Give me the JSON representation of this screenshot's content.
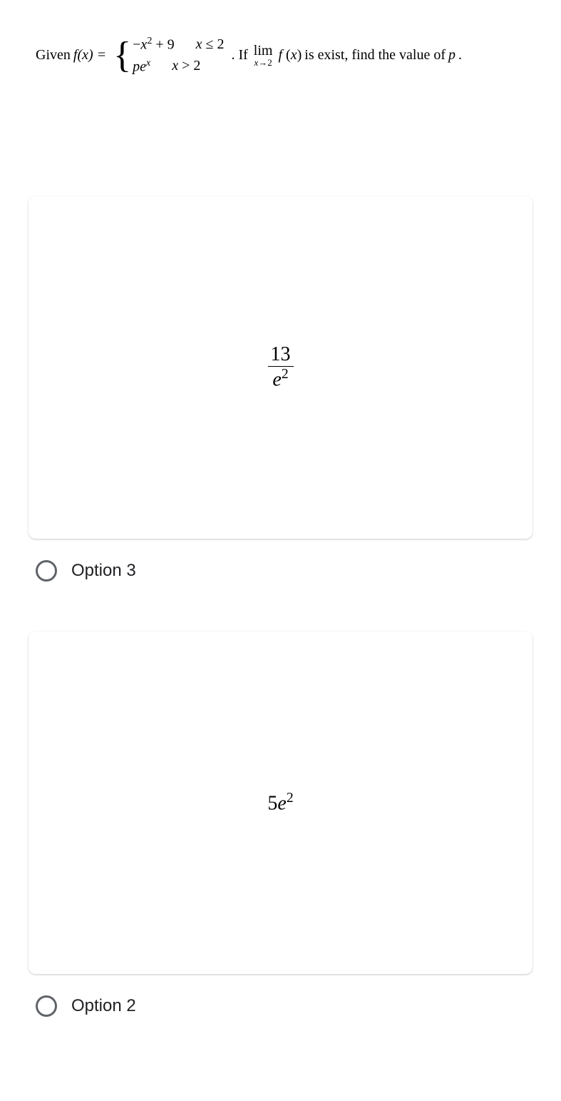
{
  "question": {
    "prefix": "Given ",
    "fx_label": "f(x) =",
    "piece1_expr": "−x² + 9",
    "piece1_cond": "x ≤ 2",
    "piece2_expr": "peˣ",
    "piece2_cond": "x > 2",
    "mid_text": ". If ",
    "limit_op": "lim",
    "limit_sub": "x→2",
    "limit_fx": "f (x)",
    "suffix": " is exist, find the value of ",
    "var": "p",
    "end": "."
  },
  "options": [
    {
      "content_type": "fraction",
      "numerator": "13",
      "denominator": "e²",
      "label": "Option 3"
    },
    {
      "content_type": "expr",
      "expr": "5e²",
      "label": "Option 2"
    }
  ]
}
